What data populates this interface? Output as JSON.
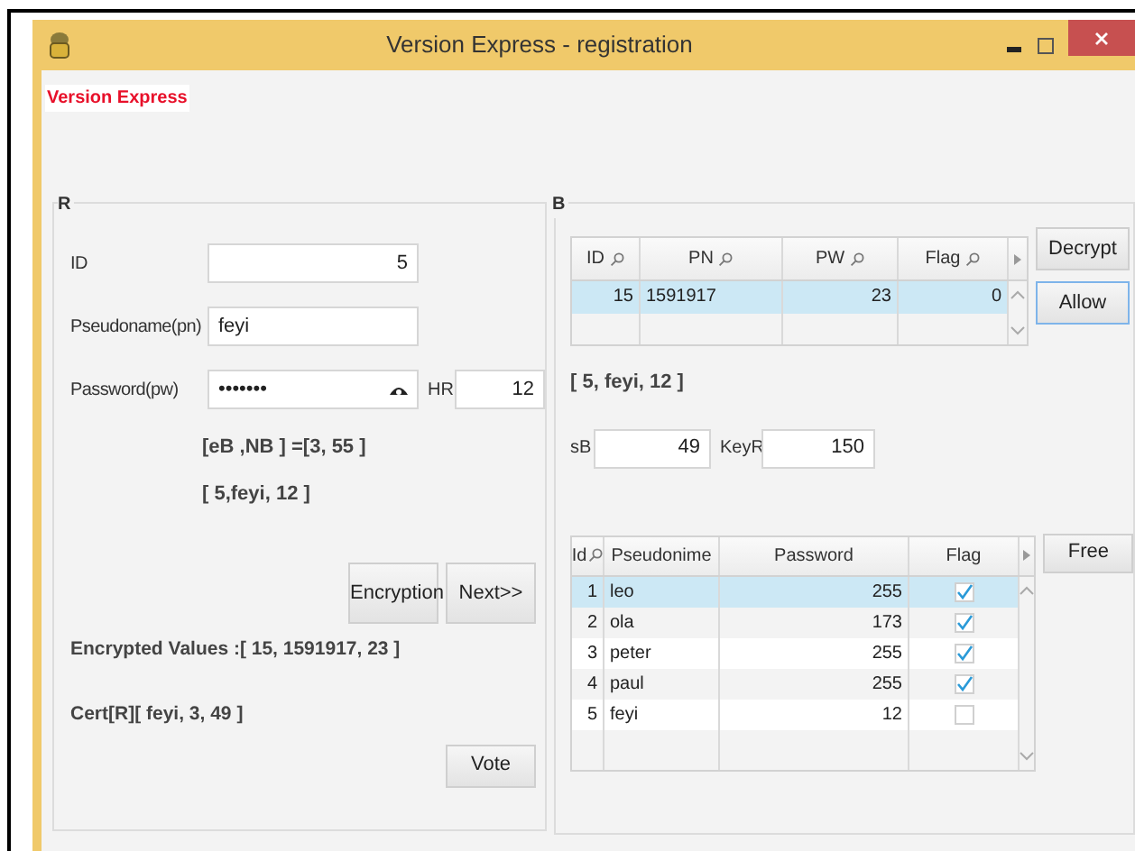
{
  "window": {
    "title": "Version Express - registration"
  },
  "app_label": "Version Express",
  "panel_r": {
    "title": "R",
    "fields": [
      {
        "label": "ID",
        "value": "5"
      },
      {
        "label": "Pseudoname(pn)",
        "value": "feyi"
      },
      {
        "label": "Password(pw)",
        "value": "•••••••"
      }
    ],
    "hr": {
      "label": "HR",
      "value": "12"
    },
    "texts": [
      "[eB ,NB ] =[3, 55 ]",
      "[ 5,feyi, 12 ]"
    ],
    "buttons": [
      "Encryption",
      "Next>>"
    ],
    "encrypted": "Encrypted Values :[ 15, 1591917, 23 ]",
    "cert": "Cert[R][ feyi, 3, 49 ]",
    "vote_button": "Vote"
  },
  "panel_b": {
    "title": "B",
    "table": {
      "columns": [
        "ID",
        "PN",
        "PW",
        "Flag"
      ],
      "rows": [
        {
          "cells": [
            "15",
            "1591917",
            "23",
            "0"
          ],
          "selected": true
        }
      ]
    },
    "buttons": [
      {
        "label": "Decrypt",
        "focused": false
      },
      {
        "label": "Allow",
        "focused": true
      }
    ],
    "text": "[ 5, feyi, 12 ]",
    "sb": {
      "label": "sB",
      "value": "49"
    },
    "keyr": {
      "label": "KeyR",
      "value": "150"
    },
    "users": {
      "columns": [
        "Id",
        "Pseudonime",
        "Password",
        "Flag"
      ],
      "rows": [
        {
          "id": "1",
          "name": "leo",
          "password": "255",
          "checked": true,
          "selected": true
        },
        {
          "id": "2",
          "name": "ola",
          "password": "173",
          "checked": true,
          "selected": false
        },
        {
          "id": "3",
          "name": "peter",
          "password": "255",
          "checked": true,
          "selected": false
        },
        {
          "id": "4",
          "name": "paul",
          "password": "255",
          "checked": true,
          "selected": false
        },
        {
          "id": "5",
          "name": "feyi",
          "password": "12",
          "checked": false,
          "selected": false
        }
      ]
    },
    "free_button": "Free"
  }
}
